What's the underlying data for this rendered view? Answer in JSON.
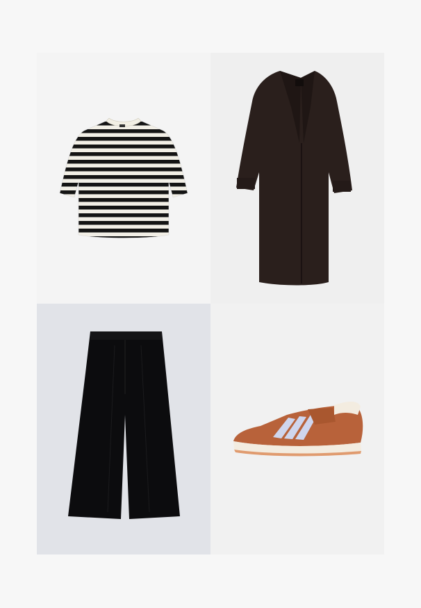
{
  "board": {
    "background": "#f7f7f7",
    "items": [
      {
        "name": "striped-tshirt",
        "colors": [
          "#111111",
          "#f2efe4"
        ]
      },
      {
        "name": "long-coat",
        "colors": [
          "#2a1f1c"
        ]
      },
      {
        "name": "wide-leg-trousers",
        "colors": [
          "#0c0c0e"
        ]
      },
      {
        "name": "retro-sneaker",
        "colors": [
          "#b8623a",
          "#cfd6ee",
          "#f3ece0"
        ]
      }
    ]
  }
}
